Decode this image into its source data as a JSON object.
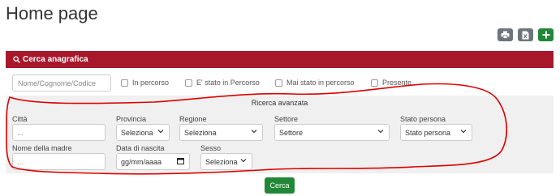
{
  "page": {
    "title": "Home page"
  },
  "toolbar": {
    "print_icon": "print-icon",
    "excel_icon": "excel-icon",
    "add_icon": "plus-icon",
    "colors": {
      "gray": "#6c757d",
      "green": "#218838"
    }
  },
  "panel": {
    "title": "Cerca anagrafica",
    "color": "#a8182c"
  },
  "search": {
    "placeholder": "Nome/Cognome/Codice"
  },
  "filters": {
    "in_percorso": "In percorso",
    "e_stato": "E' stato in Percorso",
    "mai_stato": "Mai stato in percorso",
    "presente": "Presente"
  },
  "advanced": {
    "title": "Ricerca avanzata",
    "citta": {
      "label": "Città",
      "placeholder": "..."
    },
    "provincia": {
      "label": "Provincia",
      "value": "Seleziona"
    },
    "regione": {
      "label": "Regione",
      "value": "Seleziona"
    },
    "settore": {
      "label": "Settore",
      "value": "Settore"
    },
    "stato_persona": {
      "label": "Stato persona",
      "value": "Stato persona"
    },
    "nome_madre": {
      "label": "Nome della madre",
      "placeholder": "..."
    },
    "data_nascita": {
      "label": "Data di nascita",
      "placeholder": "gg/mm/aaaa"
    },
    "sesso": {
      "label": "Sesso",
      "value": "Seleziona"
    }
  },
  "actions": {
    "search_label": "Cerca"
  },
  "annotation": {
    "color": "#e00000"
  }
}
